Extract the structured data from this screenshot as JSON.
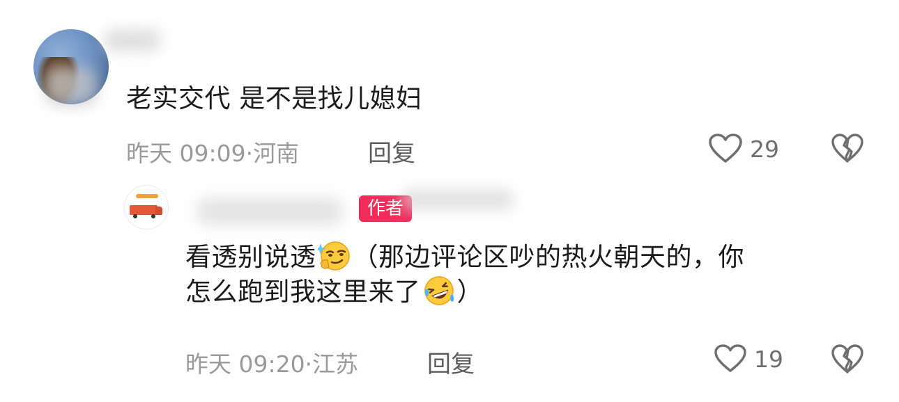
{
  "comment": {
    "text": "老实交代 是不是找儿媳妇",
    "time": "昨天 09:09",
    "location": "河南",
    "reply_label": "回复",
    "like_count": "29",
    "heart_icon": "heart-icon",
    "dislike_icon": "broken-heart-icon"
  },
  "reply": {
    "author_badge": "作者",
    "text_line1_part1": "看透别说透",
    "text_line1_part2": "（那边评论区吵的热火朝天的，你",
    "text_line2_part1": "怎么跑到我这里来了",
    "text_line2_part2": "）",
    "emoji_1": "thinking-smirk-emoji",
    "emoji_2": "rolling-on-floor-laughing-emoji",
    "time": "昨天 09:20",
    "location": "江苏",
    "reply_label": "回复",
    "like_count": "19",
    "heart_icon": "heart-icon",
    "dislike_icon": "broken-heart-icon"
  },
  "colors": {
    "text": "#1c1c1c",
    "meta": "#9a9a9a",
    "reply_button": "#5c5c5c",
    "author_badge": "#f02d5a"
  }
}
